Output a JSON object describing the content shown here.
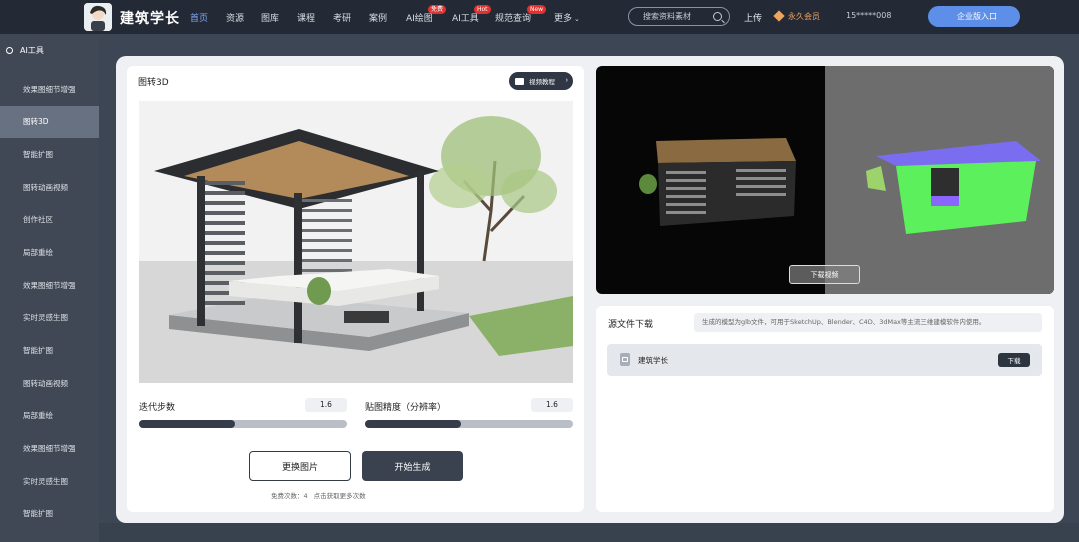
{
  "header": {
    "brand": "建筑学长",
    "nav": [
      {
        "label": "首页",
        "active": true
      },
      {
        "label": "资源"
      },
      {
        "label": "图库"
      },
      {
        "label": "课程"
      },
      {
        "label": "考研"
      },
      {
        "label": "案例"
      },
      {
        "label": "AI绘图",
        "badge": "免费"
      },
      {
        "label": "AI工具",
        "badge": "Hot"
      },
      {
        "label": "规范查询",
        "badge": "New"
      },
      {
        "label": "更多"
      }
    ],
    "search_placeholder": "搜索资料素材",
    "upload": "上传",
    "vip": "永久会员",
    "phone": "15*****008",
    "enterprise": "企业版入口"
  },
  "sidebar": {
    "heading": "AI工具",
    "items": [
      {
        "label": "效果图细节增强"
      },
      {
        "label": "图转3D",
        "active": true
      },
      {
        "label": "智能扩图"
      },
      {
        "label": "图转动画视频"
      },
      {
        "label": "创作社区"
      },
      {
        "label": "局部重绘"
      },
      {
        "label": "效果图细节增强"
      },
      {
        "label": "实时灵感生图"
      },
      {
        "label": "智能扩图"
      },
      {
        "label": "图转动画视频"
      },
      {
        "label": "局部重绘"
      },
      {
        "label": "效果图细节增强"
      },
      {
        "label": "实时灵感生图"
      },
      {
        "label": "智能扩图"
      }
    ]
  },
  "left_card": {
    "title": "图转3D",
    "tutorial": "视频教程",
    "iterations_label": "迭代步数",
    "iterations_value": "1.6",
    "iterations_fraction": 0.46,
    "texture_label": "贴图精度（分辨率）",
    "texture_value": "1.6",
    "texture_fraction": 0.46,
    "change_image": "更换图片",
    "start": "开始生成",
    "free_count": "免费次数：4",
    "get_more": "点击获取更多次数"
  },
  "right": {
    "download_video": "下载视频",
    "source_title": "源文件下载",
    "source_note": "生成的模型为glb文件，可用于SketchUp、Blender、C4D、3dMax等主流三维建模软件内使用。",
    "file_name": "建筑学长",
    "download": "下载"
  },
  "colors": {
    "topbar": "#232a36",
    "sidebar": "#404855",
    "accent": "#5d8fe8",
    "primary_button": "#3a4250"
  }
}
